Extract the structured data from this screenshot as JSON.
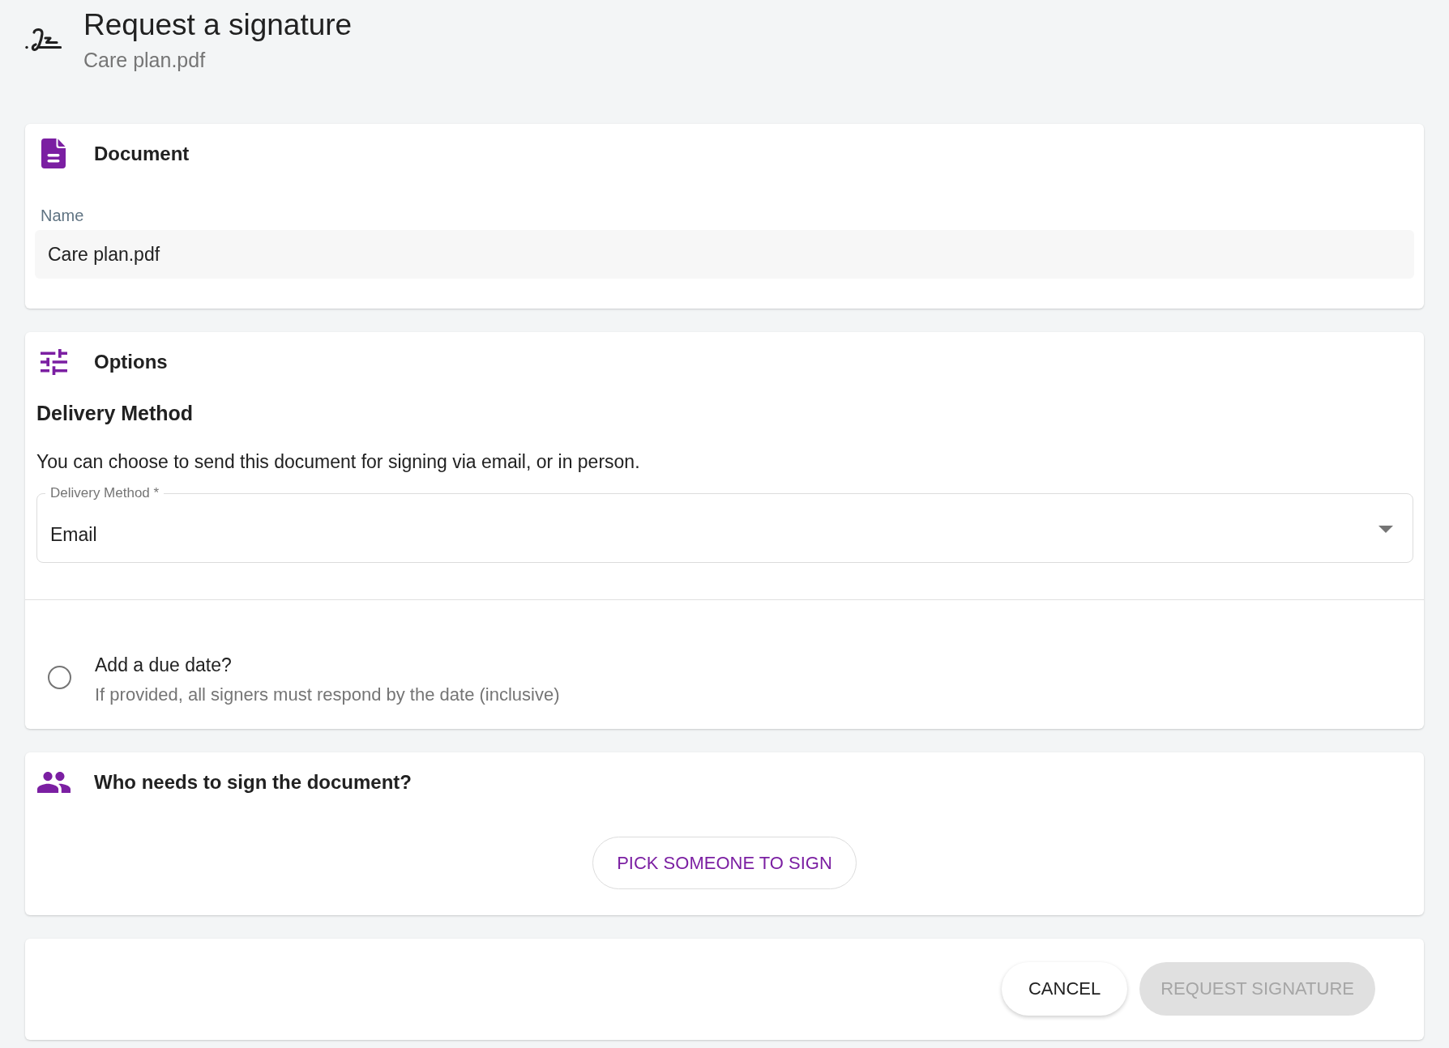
{
  "header": {
    "title": "Request a signature",
    "subtitle": "Care plan.pdf"
  },
  "document_section": {
    "heading": "Document",
    "name_field": {
      "label": "Name",
      "value": "Care plan.pdf"
    }
  },
  "options_section": {
    "heading": "Options",
    "subheading": "Delivery Method",
    "description": "You can choose to send this document for signing via email, or in person.",
    "delivery_method": {
      "label": "Delivery Method *",
      "value": "Email"
    },
    "due_date": {
      "label": "Add a due date?",
      "hint": "If provided, all signers must respond by the date (inclusive)",
      "checked": false
    }
  },
  "signers_section": {
    "heading": "Who needs to sign the document?",
    "button": "PICK SOMEONE TO SIGN"
  },
  "actions": [
    {
      "label": "CANCEL",
      "kind": "secondary",
      "disabled": false
    },
    {
      "label": "REQUEST SIGNATURE",
      "kind": "primary",
      "disabled": true
    }
  ]
}
